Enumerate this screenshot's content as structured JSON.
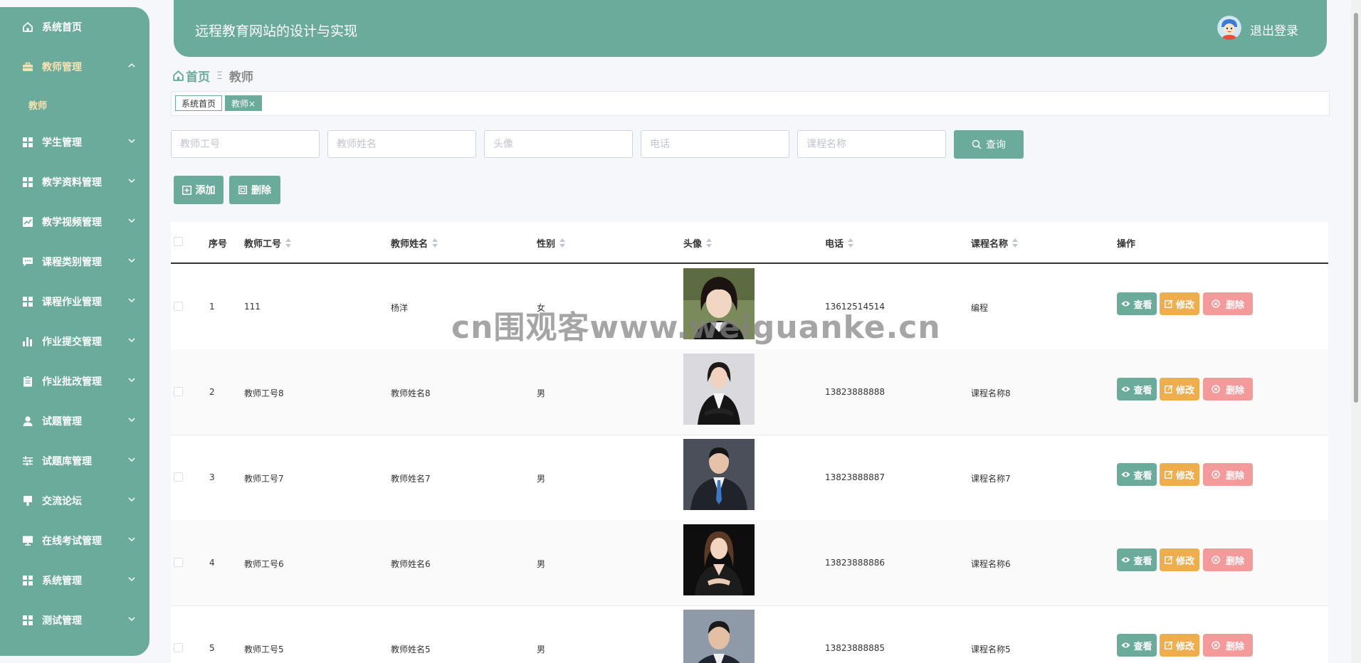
{
  "sidebar": {
    "items": [
      {
        "label": "系统首页",
        "icon": "home-icon",
        "chevron": ""
      },
      {
        "label": "教师管理",
        "icon": "briefcase-icon",
        "chevron": "up"
      },
      {
        "label": "学生管理",
        "icon": "grid-icon",
        "chevron": "down"
      },
      {
        "label": "教学资料管理",
        "icon": "grid-icon",
        "chevron": "down"
      },
      {
        "label": "教学视频管理",
        "icon": "chart-icon",
        "chevron": "down"
      },
      {
        "label": "课程类别管理",
        "icon": "chat-icon",
        "chevron": "down"
      },
      {
        "label": "课程作业管理",
        "icon": "grid-icon",
        "chevron": "down"
      },
      {
        "label": "作业提交管理",
        "icon": "bar-chart-icon",
        "chevron": "down"
      },
      {
        "label": "作业批改管理",
        "icon": "clipboard-icon",
        "chevron": "down"
      },
      {
        "label": "试题管理",
        "icon": "user-icon",
        "chevron": "down"
      },
      {
        "label": "试题库管理",
        "icon": "sliders-icon",
        "chevron": "down"
      },
      {
        "label": "交流论坛",
        "icon": "forum-icon",
        "chevron": "down"
      },
      {
        "label": "在线考试管理",
        "icon": "monitor-icon",
        "chevron": "down"
      },
      {
        "label": "系统管理",
        "icon": "grid-icon",
        "chevron": "down"
      },
      {
        "label": "测试管理",
        "icon": "grid-icon",
        "chevron": "down"
      }
    ],
    "sub_item": "教师"
  },
  "header": {
    "title": "远程教育网站的设计与实现",
    "logout": "退出登录",
    "avatar_icon": "user-avatar-icon"
  },
  "breadcrumb": {
    "home": "首页",
    "current": "教师"
  },
  "tags": {
    "home": "系统首页",
    "current": "教师",
    "close_symbol": "×"
  },
  "search": {
    "teacher_no_placeholder": "教师工号",
    "teacher_name_placeholder": "教师姓名",
    "avatar_placeholder": "头像",
    "phone_placeholder": "电话",
    "course_placeholder": "课程名称",
    "query_label": "查询"
  },
  "actions": {
    "add_label": "添加",
    "delete_label": "删除"
  },
  "table": {
    "headers": {
      "index": "序号",
      "teacher_no": "教师工号",
      "teacher_name": "教师姓名",
      "gender": "性别",
      "avatar": "头像",
      "phone": "电话",
      "course": "课程名称",
      "ops": "操作"
    },
    "rows": [
      {
        "index": "1",
        "teacher_no": "111",
        "teacher_name": "杨洋",
        "gender": "女",
        "phone": "13612514514",
        "course": "编程"
      },
      {
        "index": "2",
        "teacher_no": "教师工号8",
        "teacher_name": "教师姓名8",
        "gender": "男",
        "phone": "13823888888",
        "course": "课程名称8"
      },
      {
        "index": "3",
        "teacher_no": "教师工号7",
        "teacher_name": "教师姓名7",
        "gender": "男",
        "phone": "13823888887",
        "course": "课程名称7"
      },
      {
        "index": "4",
        "teacher_no": "教师工号6",
        "teacher_name": "教师姓名6",
        "gender": "男",
        "phone": "13823888886",
        "course": "课程名称6"
      },
      {
        "index": "5",
        "teacher_no": "教师工号5",
        "teacher_name": "教师姓名5",
        "gender": "男",
        "phone": "13823888885",
        "course": "课程名称5"
      }
    ],
    "row_buttons": {
      "view": "查看",
      "edit": "修改",
      "delete": "删除"
    }
  },
  "watermark": "cn围观客www.weiguanke.cn",
  "colors": {
    "primary": "#6aab9c",
    "edit": "#f0ad4e",
    "danger": "#f49a9a",
    "active_menu_text": "#f3e3b4"
  }
}
